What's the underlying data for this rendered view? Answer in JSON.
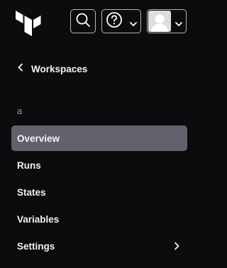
{
  "topbar": {
    "logo_icon": "terraform-logo-icon",
    "search_icon": "search-icon",
    "help_icon": "help-circle-icon",
    "user_icon": "user-avatar-icon",
    "dropdown_icon": "chevron-down-icon"
  },
  "back": {
    "label": "Workspaces",
    "icon": "chevron-left-icon"
  },
  "workspace": {
    "name": "a"
  },
  "nav": {
    "items": [
      {
        "label": "Overview",
        "active": true
      },
      {
        "label": "Runs",
        "active": false
      },
      {
        "label": "States",
        "active": false
      },
      {
        "label": "Variables",
        "active": false
      },
      {
        "label": "Settings",
        "active": false,
        "has_submenu": true
      }
    ]
  },
  "colors": {
    "background": "#0c0c0e",
    "active_item": "#62626c",
    "text": "#f2f2f4",
    "muted_text": "#9a9aa2",
    "border": "#b4b4bb"
  }
}
